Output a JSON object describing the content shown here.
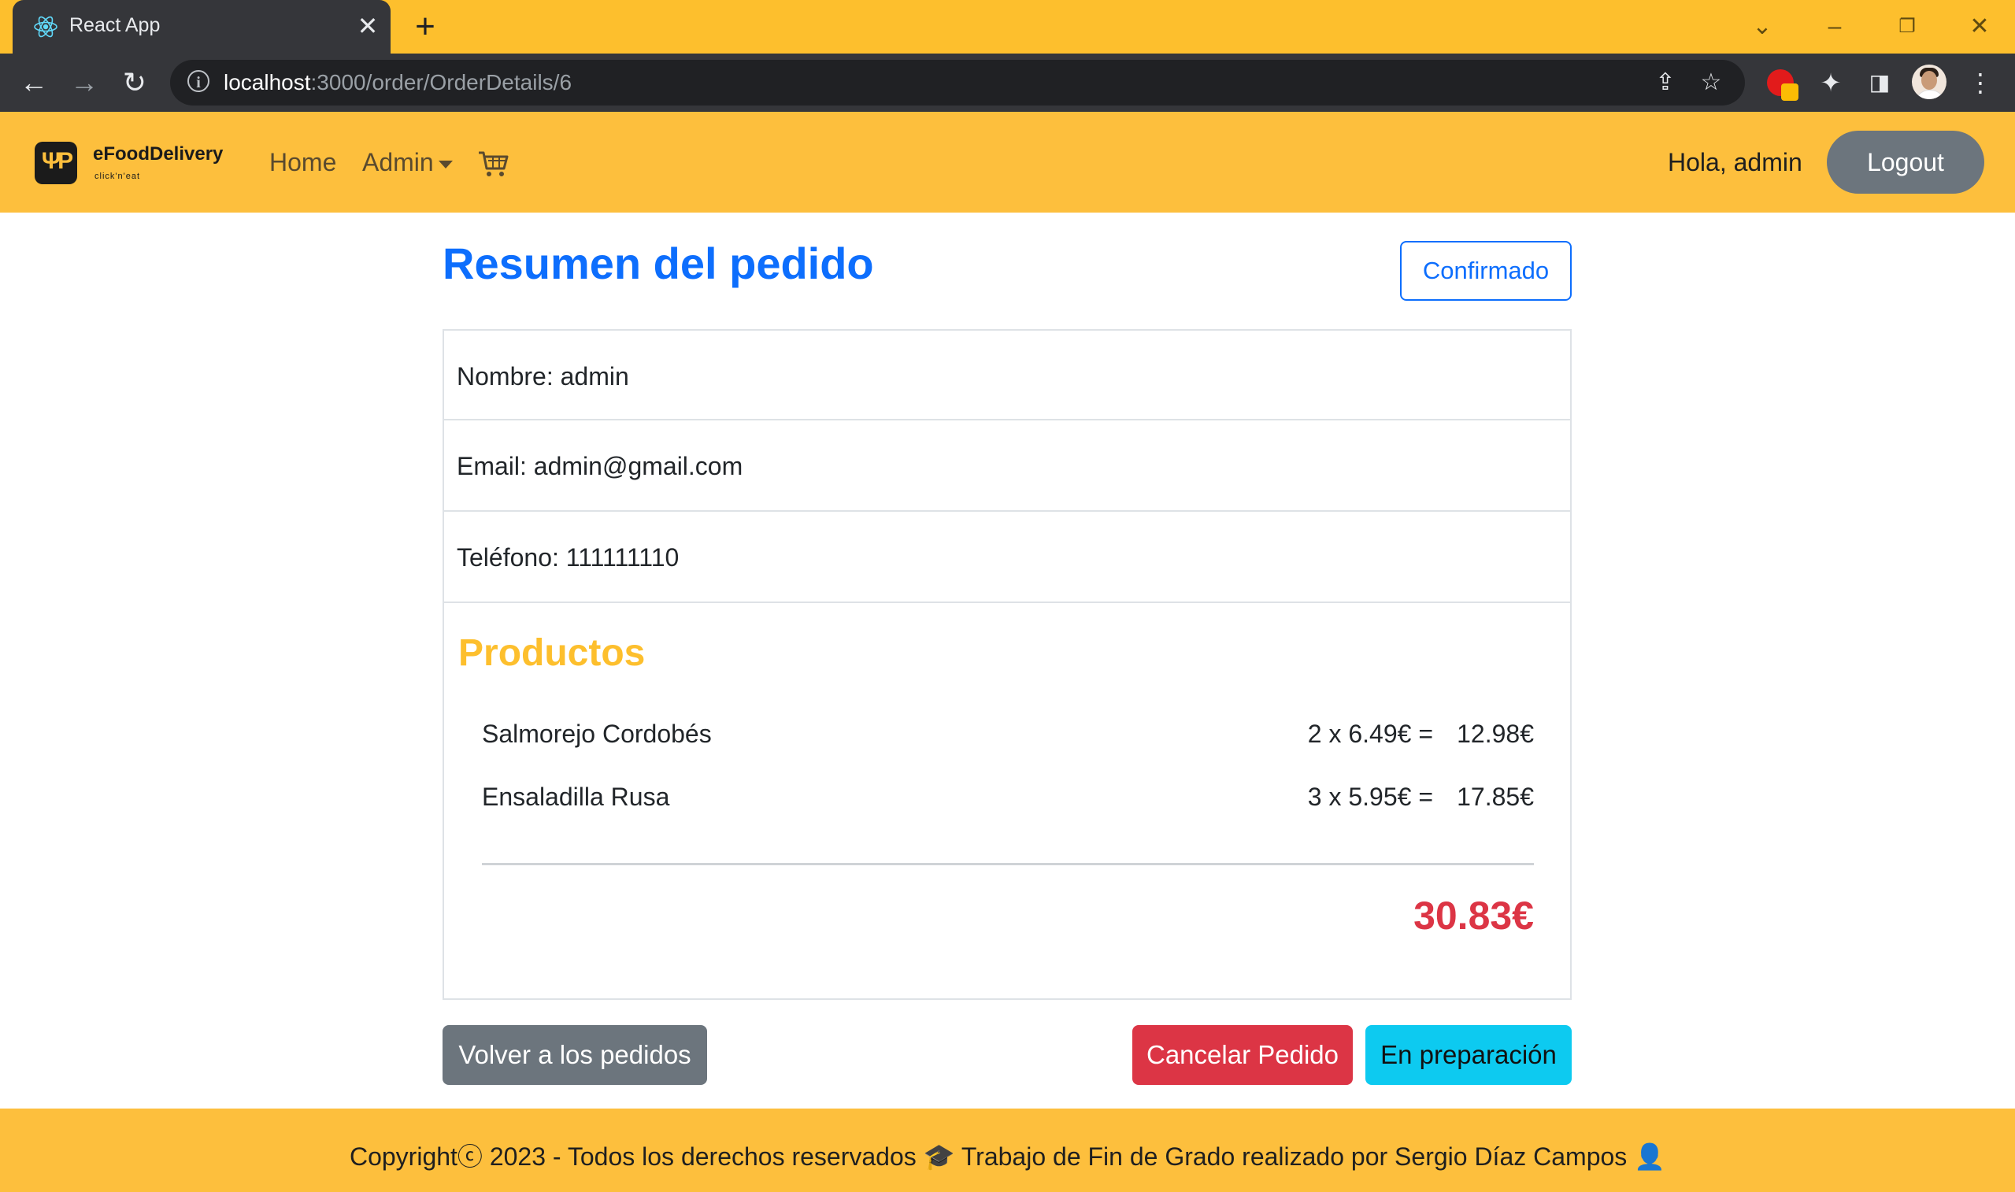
{
  "browser": {
    "tab_title": "React App",
    "tab_close": "✕",
    "new_tab": "+",
    "url_host": "localhost",
    "url_path": ":3000/order/OrderDetails/6",
    "icons": [
      "back-icon",
      "forward-icon",
      "reload-icon",
      "info-icon",
      "share-icon",
      "star-icon",
      "extension-icon",
      "puzzle-icon",
      "sidepanel-icon",
      "profile-avatar",
      "menu-icon"
    ]
  },
  "navbar": {
    "brand_name": "eFoodDelivery",
    "brand_tagline": "click'n'eat",
    "links": {
      "home": "Home",
      "admin": "Admin"
    },
    "greeting": "Hola, admin",
    "logout": "Logout"
  },
  "order": {
    "title": "Resumen del pedido",
    "status": "Confirmado",
    "name": "Nombre: admin",
    "email": "Email: admin@gmail.com",
    "phone": "Teléfono: 111111110",
    "products_title": "Productos",
    "products": [
      {
        "name": "Salmorejo Cordobés",
        "qty": "2 x 6.49€ =",
        "subtotal": "12.98€"
      },
      {
        "name": "Ensaladilla Rusa",
        "qty": "3 x 5.95€ =",
        "subtotal": "17.85€"
      }
    ],
    "total": "30.83€"
  },
  "actions": {
    "back": "Volver a los pedidos",
    "cancel": "Cancelar Pedido",
    "prepare": "En preparación"
  },
  "footer": {
    "text": "Copyrightⓒ 2023 - Todos los derechos reservados 🎓 Trabajo de Fin de Grado realizado por Sergio Díaz Campos 👤"
  },
  "colors": {
    "brand_yellow": "#fdbf3d",
    "primary": "#0d6efd",
    "danger": "#dc3545",
    "info": "#0dcaf0",
    "secondary": "#6c757d"
  }
}
